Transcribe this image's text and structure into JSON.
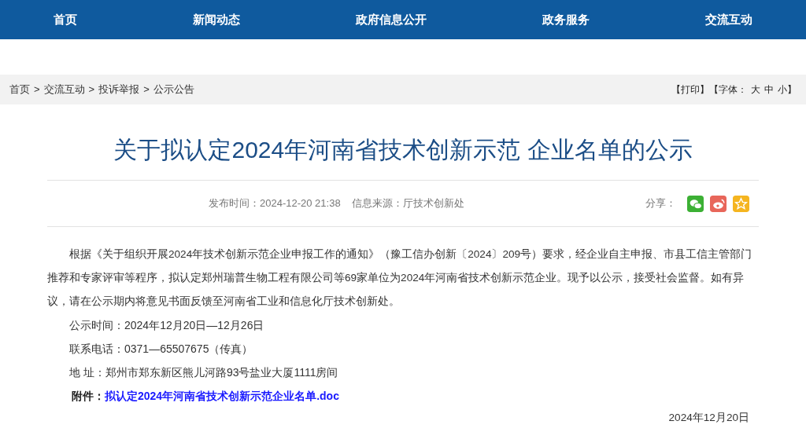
{
  "nav": [
    {
      "label": "首页"
    },
    {
      "label": "新闻动态"
    },
    {
      "label": "政府信息公开"
    },
    {
      "label": "政务服务"
    },
    {
      "label": "交流互动"
    }
  ],
  "breadcrumb": {
    "items": [
      "首页",
      "交流互动",
      "投诉举报",
      "公示公告"
    ],
    "separator": ">"
  },
  "tools": {
    "print": "【打印】",
    "font_label": "【字体：",
    "sizes": [
      "大",
      "中",
      "小"
    ],
    "close": "】"
  },
  "article": {
    "title": "关于拟认定2024年河南省技术创新示范 企业名单的公示",
    "published": "发布时间：2024-12-20 21:38",
    "source": "信息来源：厅技术创新处",
    "share_label": "分享：",
    "share": [
      {
        "kind": "wechat",
        "color": "#3cb034"
      },
      {
        "kind": "weibo",
        "color": "#e8665a"
      },
      {
        "kind": "favorite",
        "color": "#f5b520"
      }
    ],
    "body": "根据《关于组织开展2024年技术创新示范企业申报工作的通知》（豫工信办创新〔2024〕209号）要求，经企业自主申报、市县工信主管部门推荐和专家评审等程序，拟认定郑州瑞普生物工程有限公司等69家单位为2024年河南省技术创新示范企业。现予以公示，接受社会监督。如有异议，请在公示期内将意见书面反馈至河南省工业和信息化厅技术创新处。",
    "info": [
      "公示时间：2024年12月20日—12月26日",
      "联系电话：0371—65507675（传真）",
      "地 址：郑州市郑东新区熊儿河路93号盐业大厦1111房间"
    ],
    "attachment": {
      "label": "附件：",
      "link": "拟认定2024年河南省技术创新示范企业名单.doc"
    },
    "date": "2024年12月20日"
  }
}
